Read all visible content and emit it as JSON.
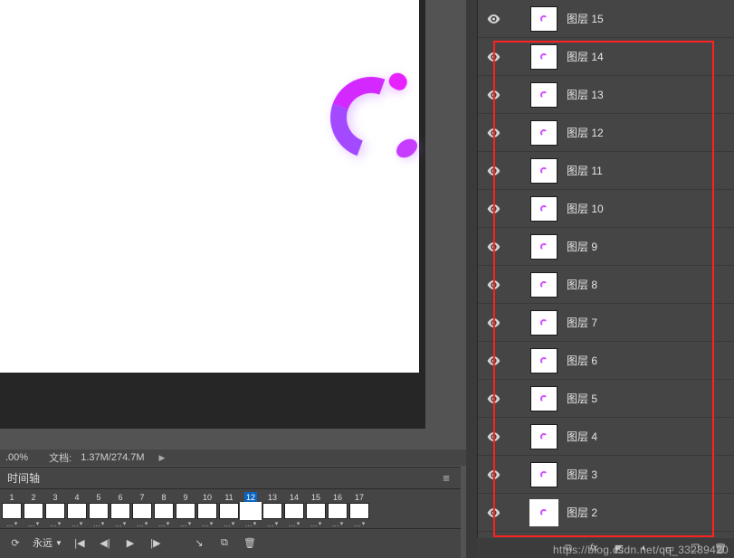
{
  "canvas": {
    "bg": "#ffffff"
  },
  "status": {
    "zoom": ".00%",
    "doc_label": "文档:",
    "doc_value": "1.37M/274.7M"
  },
  "timeline": {
    "title": "时间轴",
    "frames": [
      {
        "n": "1"
      },
      {
        "n": "2"
      },
      {
        "n": "3"
      },
      {
        "n": "4"
      },
      {
        "n": "5"
      },
      {
        "n": "6"
      },
      {
        "n": "7"
      },
      {
        "n": "8"
      },
      {
        "n": "9"
      },
      {
        "n": "10"
      },
      {
        "n": "11"
      },
      {
        "n": "12"
      },
      {
        "n": "13"
      },
      {
        "n": "14"
      },
      {
        "n": "15"
      },
      {
        "n": "16"
      },
      {
        "n": "17"
      }
    ],
    "selected_index": 11,
    "loop_label": "永远"
  },
  "layers": {
    "items": [
      {
        "label": "图层 15"
      },
      {
        "label": "图层 14"
      },
      {
        "label": "图层 13"
      },
      {
        "label": "图层 12"
      },
      {
        "label": "图层 11"
      },
      {
        "label": "图层 10"
      },
      {
        "label": "图层 9"
      },
      {
        "label": "图层 8"
      },
      {
        "label": "图层 7"
      },
      {
        "label": "图层 6"
      },
      {
        "label": "图层 5"
      },
      {
        "label": "图层 4"
      },
      {
        "label": "图层 3"
      },
      {
        "label": "图层 2"
      }
    ],
    "selected_index": 13
  },
  "watermark": "https://blog.csdn.net/qq_33239420"
}
